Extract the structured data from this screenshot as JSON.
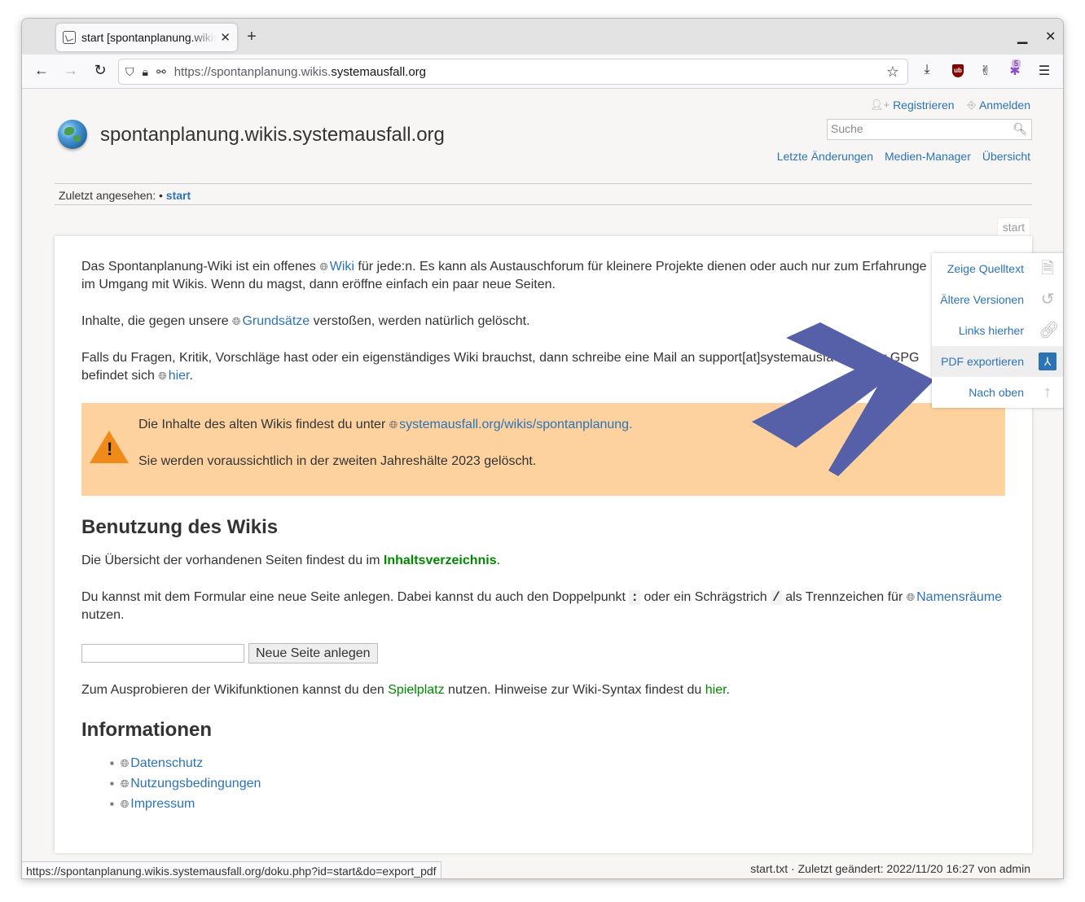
{
  "browser": {
    "tab_title": "start [spontanplanung.wikis.systemausfall.org]",
    "url_prefix": "https://spontanplanung.wikis.",
    "url_host": "systemausfall.org",
    "extension_badge": "5",
    "status_url": "https://spontanplanung.wikis.systemausfall.org/doku.php?id=start&do=export_pdf"
  },
  "header": {
    "site_title": "spontanplanung.wikis.systemausfall.org",
    "register": "Registrieren",
    "login": "Anmelden",
    "search_placeholder": "Suche",
    "site_tools": [
      "Letzte Änderungen",
      "Medien-Manager",
      "Übersicht"
    ],
    "breadcrumb_label": "Zuletzt angesehen:",
    "breadcrumb_sep": "•",
    "breadcrumb_item": "start",
    "page_id": "start"
  },
  "content": {
    "p1a": "Das Spontanplanung-Wiki ist ein offenes",
    "p1_link": "Wiki",
    "p1b": "für jede:n. Es kann als Austauschforum für kleinere Projekte dienen oder auch nur zum Erfahrunge",
    "p1c": "im Umgang mit Wikis. Wenn du magst, dann eröffne einfach ein paar neue Seiten.",
    "p2a": "Inhalte, die gegen unsere",
    "p2_link": "Grundsätze",
    "p2b": "verstoßen, werden natürlich gelöscht.",
    "p3a": "Falls du Fragen, Kritik, Vorschläge hast oder ein eigenständiges Wiki brauchst, dann schreibe eine Mail an support[at]systemausfa",
    "p3a_tail": "r GPG",
    "p3b": "befindet sich",
    "p3_link": "hier",
    "p3c": ".",
    "note1a": "Die Inhalte des alten Wikis findest du unter",
    "note1_link": "systemausfall.org/wikis/spontanplanung.",
    "note2": "Sie werden voraussichtlich in der zweiten Jahreshälte 2023 gelöscht.",
    "h_usage": "Benutzung des Wikis",
    "u1a": "Die Übersicht der vorhandenen Seiten findest du im",
    "u1_link": "Inhaltsverzeichnis",
    "u1b": ".",
    "u2a": "Du kannst mit dem Formular eine neue Seite anlegen. Dabei kannst du auch den Doppelpunkt",
    "u2_code1": ":",
    "u2b": "oder ein Schrägstrich",
    "u2_code2": "/",
    "u2c": "als Trennzeichen für",
    "u2_link": "Namensräume",
    "u2d": "nutzen.",
    "newpage_button": "Neue Seite anlegen",
    "u3a": "Zum Ausprobieren der Wikifunktionen kannst du den",
    "u3_link1": "Spielplatz",
    "u3b": "nutzen. Hinweise zur Wiki-Syntax findest du",
    "u3_link2": "hier",
    "u3c": ".",
    "h_info": "Informationen",
    "info_links": [
      "Datenschutz",
      "Nutzungsbedingungen",
      "Impressum"
    ]
  },
  "pagetools": {
    "items": [
      "Zeige Quelltext",
      "Ältere Versionen",
      "Links hierher",
      "PDF exportieren",
      "Nach oben"
    ],
    "active": "PDF exportieren"
  },
  "footer": {
    "info": "start.txt · Zuletzt geändert: 2022/11/20 16:27 von admin"
  },
  "colors": {
    "link": "#2b73b7",
    "internal_link": "#008800",
    "note_bg": "#fdd29f",
    "arrow": "#5560a8"
  }
}
